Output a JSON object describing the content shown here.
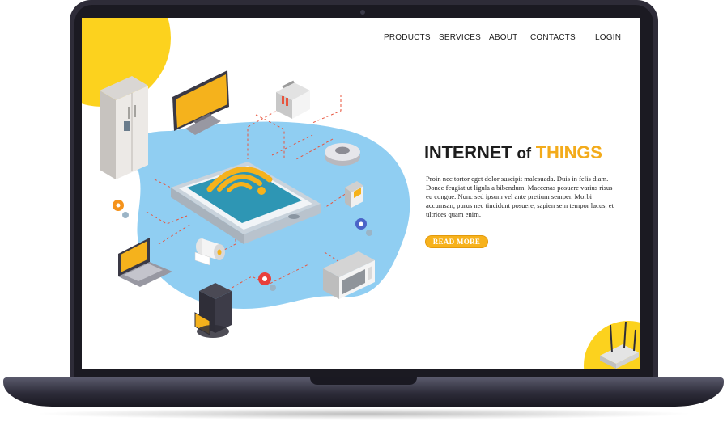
{
  "nav": {
    "items": [
      {
        "label": "PRODUCTS"
      },
      {
        "label": "SERVICES"
      },
      {
        "label": "ABOUT"
      },
      {
        "label": "CONTACTS"
      },
      {
        "label": "LOGIN"
      }
    ]
  },
  "hero": {
    "title_part1": "INTERNET",
    "title_part2": "of",
    "title_part3": "THINGS",
    "body": "Proin nec tortor eget dolor suscipit malesuada. Duis in felis diam. Donec feugiat ut ligula a bibendum. Maecenas posuere varius risus eu congue. Nunc sed ipsum vel ante pretium semper. Morbi accumsan, purus nec tincidunt posuere, sapien sem tempor lacus, et ultrices quam enim.",
    "cta_label": "READ MORE"
  },
  "device_icons": [
    "refrigerator-icon",
    "monitor-icon",
    "toaster-icon",
    "robot-vacuum-icon",
    "thermostat-icon",
    "smartphone-icon",
    "wifi-icon",
    "gear-icon",
    "laptop-icon",
    "paper-roll-icon",
    "microwave-icon",
    "coffee-maker-icon",
    "router-icon"
  ],
  "colors": {
    "accent_yellow": "#fcd21e",
    "title_highlight": "#f3ab1b",
    "button": "#f7b21c",
    "blob_blue": "#7cc6f0",
    "dashed_lines": "#e8553e",
    "laptop_frame": "#2e2c38"
  }
}
